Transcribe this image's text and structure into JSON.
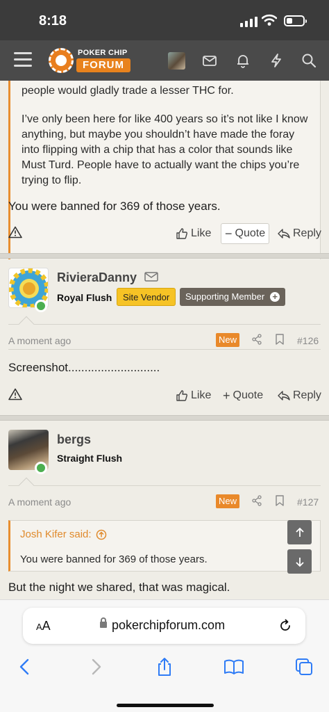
{
  "status_bar": {
    "time": "8:18"
  },
  "header": {
    "logo_top": "POKER CHIP",
    "logo_bottom": "FORUM",
    "icons": [
      "menu-icon",
      "avatar",
      "mail-icon",
      "bell-icon",
      "bolt-icon",
      "search-icon"
    ]
  },
  "post_prev": {
    "quote_lines": [
      "people would gladly trade a lesser THC for.",
      "I’ve only been here for like 400 years so it’s not like I know anything, but maybe you shouldn’t have made the foray into flipping with a chip that has a color that sounds like Must Turd. People have to actually want the chips you’re trying to flip."
    ],
    "text": "You were banned for 369 of those years.",
    "actions": {
      "like": "Like",
      "quote": "Quote",
      "reply": "Reply"
    }
  },
  "post_126": {
    "username": "RivieraDanny",
    "user_title": "Royal Flush",
    "badges": [
      "Site Vendor",
      "Supporting Member"
    ],
    "time": "A moment ago",
    "new_label": "New",
    "number": "#126",
    "text": "Screenshot............................",
    "actions": {
      "like": "Like",
      "quote": "Quote",
      "reply": "Reply"
    }
  },
  "post_127": {
    "username": "bergs",
    "user_title": "Straight Flush",
    "time": "A moment ago",
    "new_label": "New",
    "number": "#127",
    "quote_author": "Josh Kifer said:",
    "quote_text": "You were banned for 369 of those years.",
    "text": "But the night we shared, that was magical."
  },
  "browser": {
    "aa": "AA",
    "url": "pokerchipforum.com"
  },
  "colors": {
    "accent": "#e8821d",
    "header_bg": "#4a4a4a",
    "vendor_badge": "#f6c325",
    "ios_blue": "#2f7cf6"
  }
}
